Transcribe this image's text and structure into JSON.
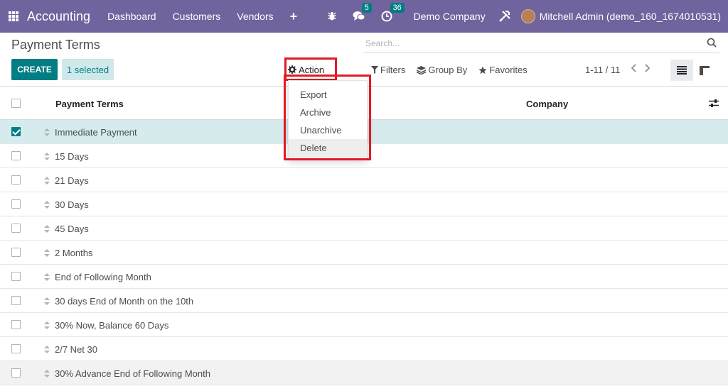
{
  "navbar": {
    "app_name": "Accounting",
    "menu": [
      "Dashboard",
      "Customers",
      "Vendors"
    ],
    "plus": "+",
    "messages_count": "5",
    "activities_count": "36",
    "company": "Demo Company",
    "user": "Mitchell Admin (demo_160_1674010531)"
  },
  "breadcrumb": "Payment Terms",
  "search": {
    "placeholder": "Search..."
  },
  "buttons": {
    "create": "CREATE",
    "selected": "1 selected",
    "action": "Action"
  },
  "search_options": {
    "filters": "Filters",
    "group_by": "Group By",
    "favorites": "Favorites"
  },
  "pager": {
    "range": "1-11 / 11"
  },
  "table": {
    "columns": {
      "name": "Payment Terms",
      "company": "Company"
    },
    "rows": [
      "Immediate Payment",
      "15 Days",
      "21 Days",
      "30 Days",
      "45 Days",
      "2 Months",
      "End of Following Month",
      "30 days End of Month on the 10th",
      "30% Now, Balance 60 Days",
      "2/7 Net 30",
      "30% Advance End of Following Month"
    ]
  },
  "action_menu": [
    "Export",
    "Archive",
    "Unarchive",
    "Delete"
  ],
  "colors": {
    "navbar": "#71639e",
    "primary": "#017e84",
    "highlight": "#e01b24"
  }
}
